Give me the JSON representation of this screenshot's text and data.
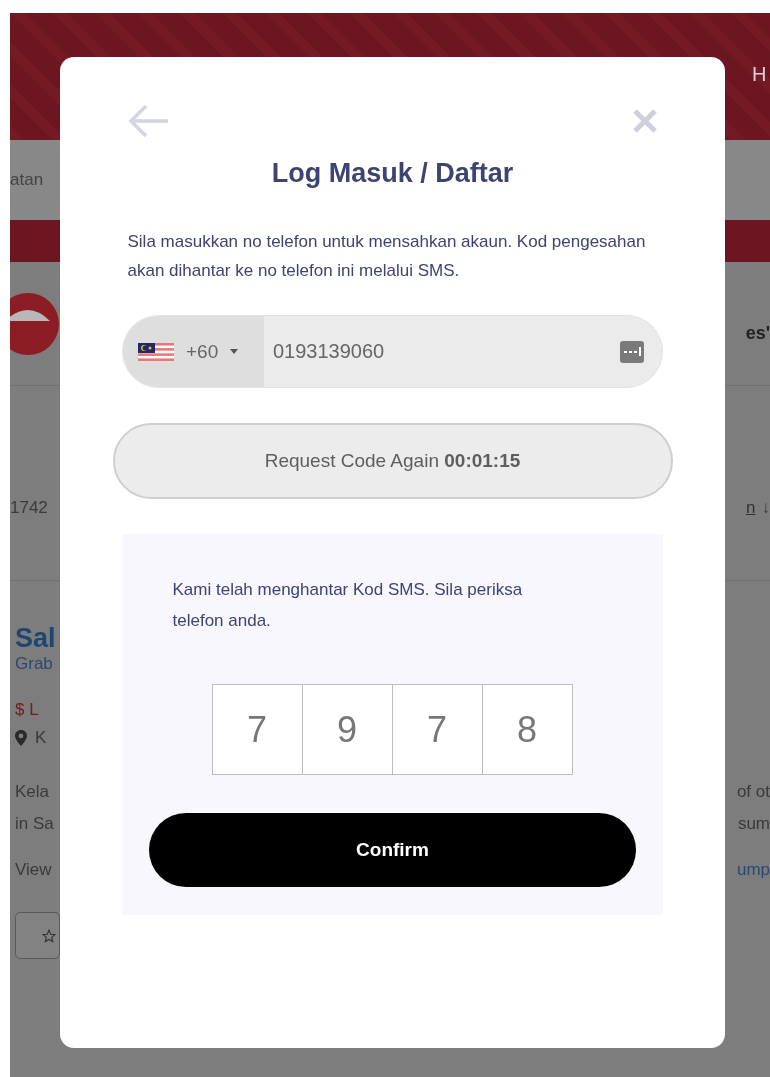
{
  "background": {
    "header_text": "H",
    "nav_text": "atan",
    "brand_text": "es'",
    "order_text": "1742",
    "sort_link": "n",
    "sort_arrow": "↓",
    "store_name": "Sal",
    "store_subtitle": "Grab",
    "price_text": "$ L",
    "location_text": "K",
    "description_rows": [
      {
        "left": "Kela",
        "right": "of ot"
      },
      {
        "left": "in Sa",
        "right": "sum"
      }
    ],
    "view_text": "View",
    "view_link": "ump"
  },
  "modal": {
    "title": "Log Masuk / Daftar",
    "instructions": "Sila masukkan no telefon untuk mensahkan akaun. Kod pengesahan akan dihantar ke no telefon ini melalui SMS.",
    "phone": {
      "country_code": "+60",
      "value": "0193139060"
    },
    "resend_button": "Request Code Again **00:01:15**",
    "otp": {
      "message": "Kami telah menghantar Kod SMS. Sila periksa telefon anda.",
      "digits": [
        "7",
        "9",
        "7",
        "8"
      ]
    },
    "confirm_button": "Confirm"
  }
}
